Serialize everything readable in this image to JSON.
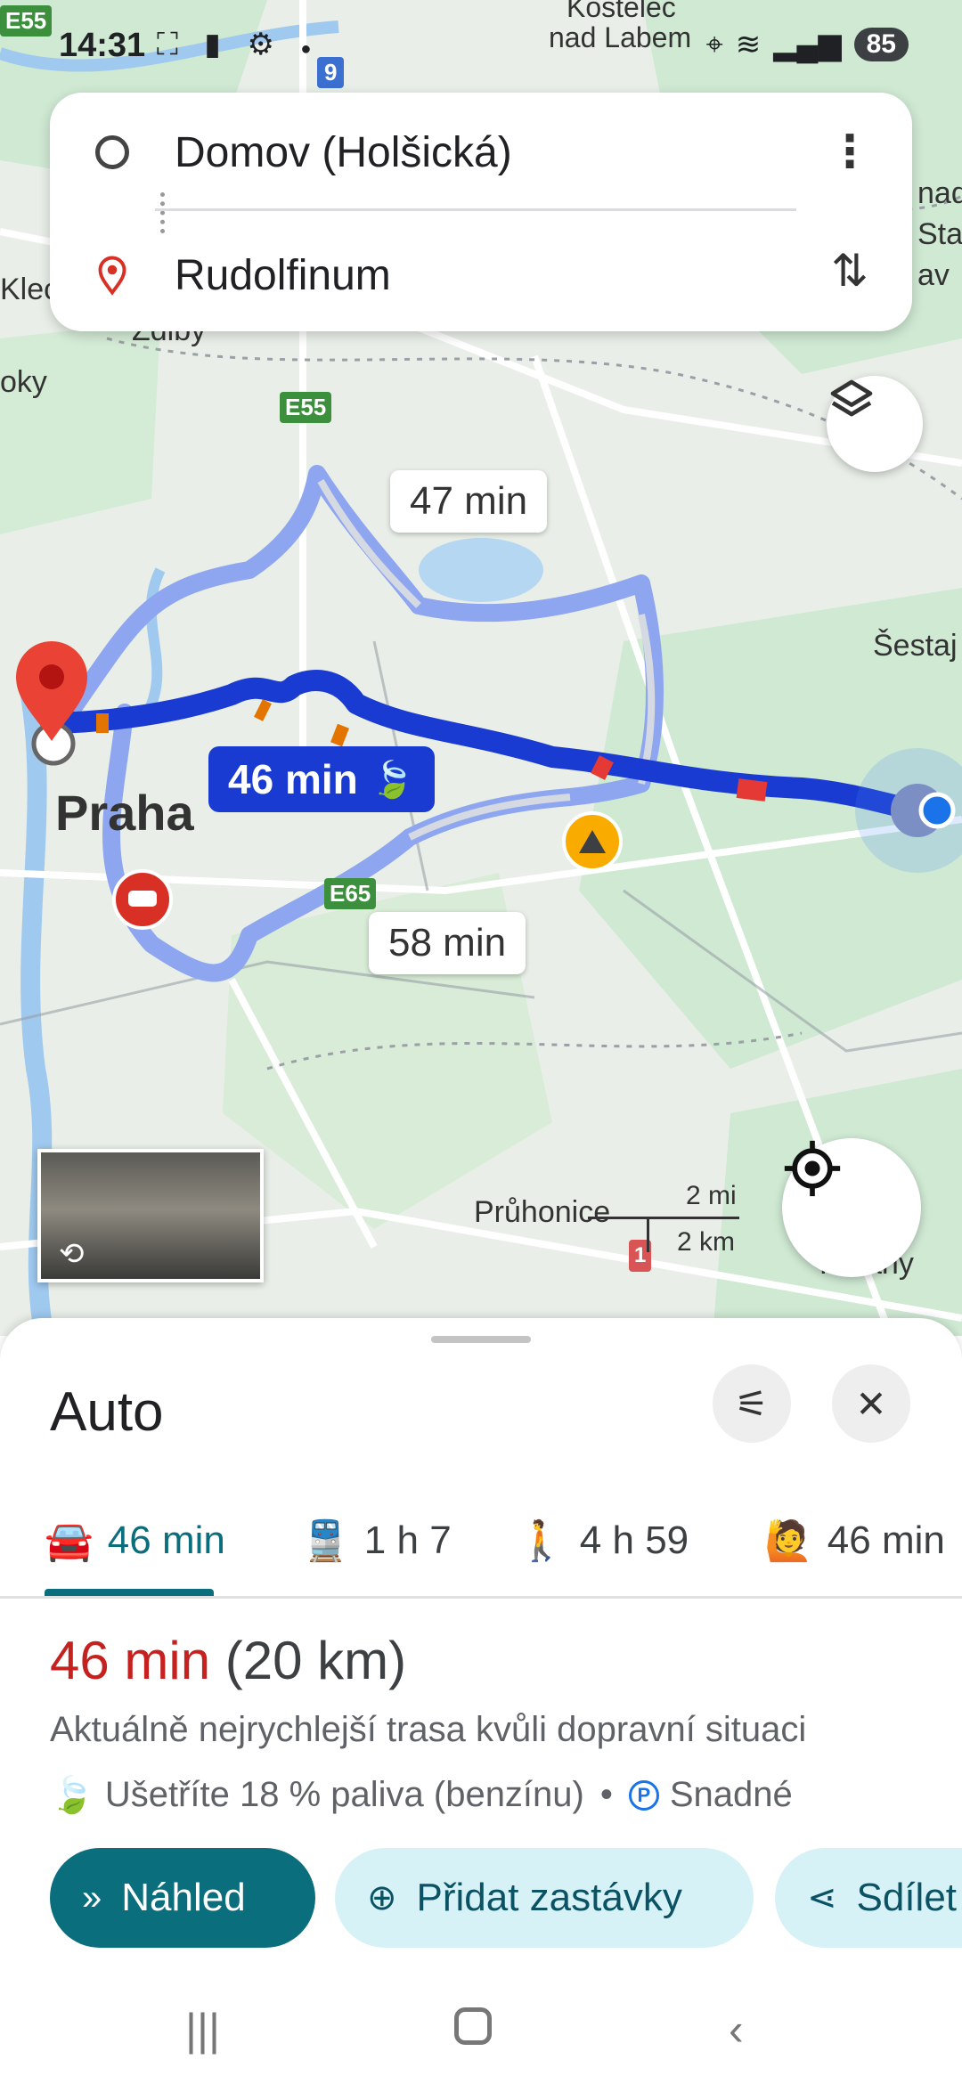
{
  "status_bar": {
    "time": "14:31",
    "icons_left": [
      "screenshot-icon",
      "bag-icon",
      "gear-icon",
      "dot"
    ],
    "battery": "85"
  },
  "search": {
    "origin": "Domov (Holšická)",
    "destination": "Rudolfinum"
  },
  "map": {
    "route_labels": {
      "alt1": "47 min",
      "main": "46 min",
      "alt2": "58 min"
    },
    "place_labels": {
      "praha": "Praha",
      "kostelec": "Kostelec",
      "nad_labem": "nad Labem",
      "sestaj": "Šestaj",
      "zdiby": "Zdiby",
      "klec": "Klec",
      "oky": "oky",
      "nad": "nad",
      "stara": "Stara",
      "av": "av",
      "pruhonice": "Průhonice",
      "richany": "Říčany"
    },
    "road_shields": {
      "e55_top": "E55",
      "e55_mid": "E55",
      "r9": "9",
      "e65": "E65",
      "r1": "1"
    },
    "scale": {
      "mi": "2 mi",
      "km": "2 km"
    }
  },
  "sheet": {
    "title": "Auto",
    "tabs": [
      {
        "mode": "car",
        "label": "46 min",
        "active": true
      },
      {
        "mode": "transit",
        "label": "1 h 7",
        "active": false
      },
      {
        "mode": "walk",
        "label": "4 h 59",
        "active": false
      },
      {
        "mode": "ride",
        "label": "46 min",
        "active": false
      }
    ],
    "summary": {
      "duration": "46 min",
      "distance": "(20 km)"
    },
    "description": "Aktuálně nejrychlejší trasa kvůli dopravní situaci",
    "fuel": "Ušetříte 18 % paliva (benzínu)",
    "parking": "Snadné",
    "buttons": {
      "preview": "Náhled",
      "add_stops": "Přidat zastávky",
      "share": "Sdílet"
    }
  },
  "colors": {
    "route_main": "#1a3bd1",
    "route_alt": "#8ea6f0",
    "accent": "#0b6e7d",
    "duration_red": "#c5221f",
    "map_green": "#cfe9d3"
  }
}
